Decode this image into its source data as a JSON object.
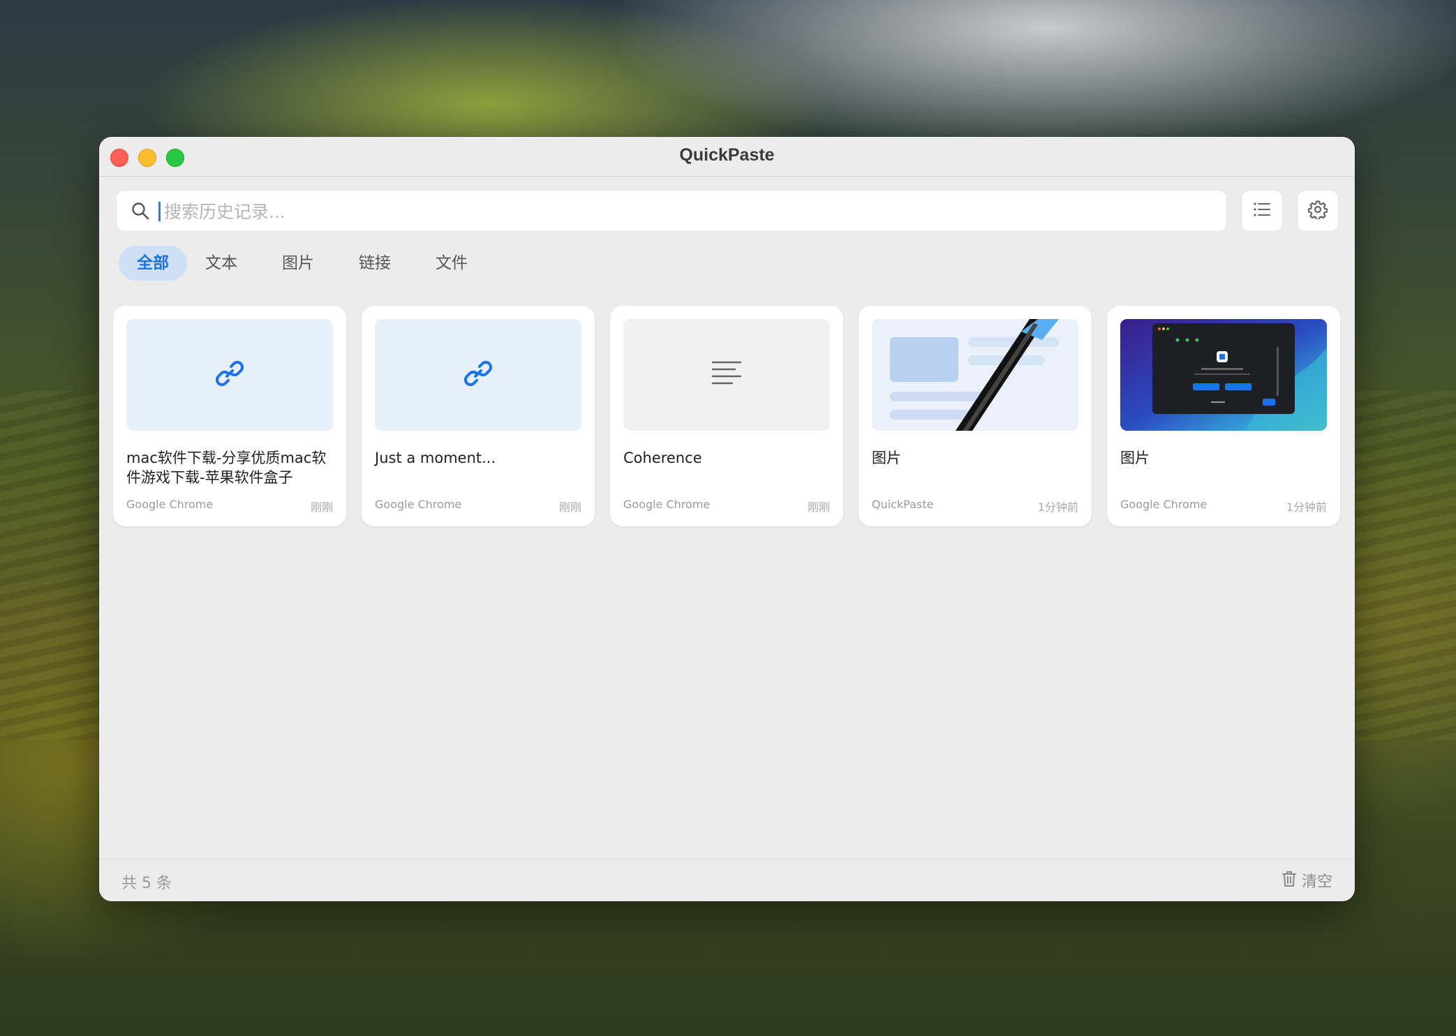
{
  "window": {
    "title": "QuickPaste"
  },
  "search": {
    "placeholder": "搜索历史记录..."
  },
  "toolbar": {
    "list_icon": "list-icon",
    "settings_icon": "gear-icon"
  },
  "tabs": [
    {
      "label": "全部",
      "active": true
    },
    {
      "label": "文本",
      "active": false
    },
    {
      "label": "图片",
      "active": false
    },
    {
      "label": "链接",
      "active": false
    },
    {
      "label": "文件",
      "active": false
    }
  ],
  "items": [
    {
      "kind": "link",
      "icon": "link-icon",
      "title": "mac软件下载-分享优质mac软件游戏下载-苹果软件盒子",
      "source": "Google Chrome",
      "time": "刚刚"
    },
    {
      "kind": "link",
      "icon": "link-icon",
      "title": "Just a moment...",
      "source": "Google Chrome",
      "time": "刚刚"
    },
    {
      "kind": "text",
      "icon": "text-align-left-icon",
      "title": "Coherence",
      "source": "Google Chrome",
      "time": "刚刚"
    },
    {
      "kind": "image",
      "icon": "image-thumbnail",
      "title": "图片",
      "source": "QuickPaste",
      "time": "1分钟前"
    },
    {
      "kind": "image",
      "icon": "image-thumbnail",
      "title": "图片",
      "source": "Google Chrome",
      "time": "1分钟前"
    }
  ],
  "footer": {
    "count": "共 5 条",
    "clear_label": "清空",
    "clear_icon": "trash-icon"
  },
  "colors": {
    "accent": "#1a73e8",
    "tab_active_bg": "#cfe0f5",
    "link_thumb_bg": "#e6f0fb"
  }
}
